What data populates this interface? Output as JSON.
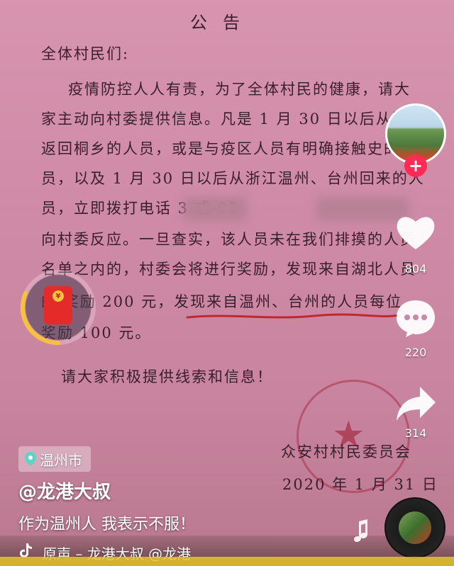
{
  "notice": {
    "title": "公告",
    "salutation": "全体村民们:",
    "lines": [
      "疫情防控人人有责，为了全体村民的健康，请大",
      "家主动向村委提供信息。凡是 1 月 30 日以后从湖北",
      "返回桐乡的人员，或是与疫区人员有明确接触史的",
      "员，以及 1 月 30 日以后从浙江温州、台州回来的人",
      "员，立即拨打电话        3 或 05",
      "向村委反应。一旦查实，该人员未在我们排摸的人员",
      "名单之内的，村委会将进行奖励，发现来自湖北人员",
      "的     奖励 200 元，发现来自温州、台州的人员每位",
      "奖励 100 元。"
    ],
    "closing": "请大家积极提供线索和信息！",
    "signature_org": "众安村村民委员会",
    "signature_date": "2020 年 1 月 31 日"
  },
  "sidebar": {
    "like_count": "804",
    "comment_count": "220",
    "share_count": "314"
  },
  "overlay": {
    "location": "温州市",
    "author": "@龙港大叔",
    "caption": "作为温州人 我表示不服！",
    "music": "原声 – 龙港大叔    @龙港"
  },
  "colors": {
    "follow": "#fe2c55",
    "redpacket": "#e52a2a",
    "ring": "#f6c23e",
    "underline": "#c0282f"
  },
  "icons": {
    "like": "heart-icon",
    "comment": "comment-icon",
    "share": "share-icon",
    "location": "location-pin-icon",
    "music": "tiktok-note-icon"
  }
}
